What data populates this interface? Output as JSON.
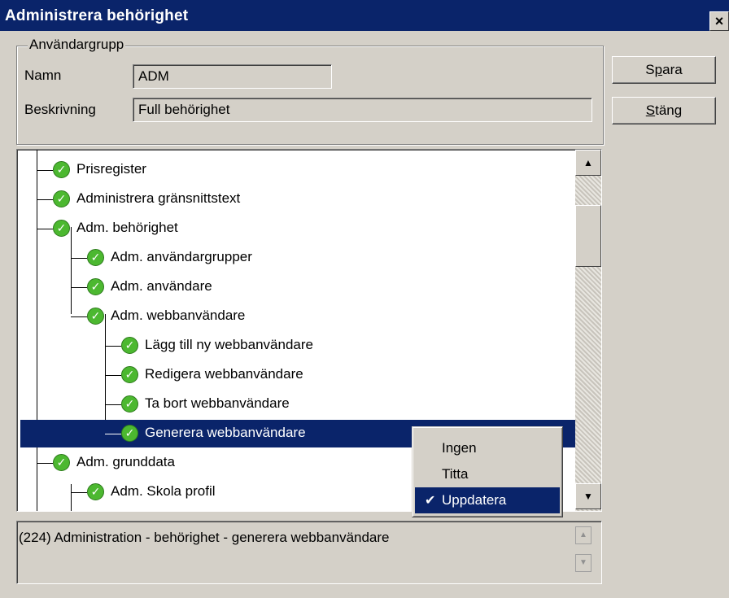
{
  "window": {
    "title": "Administrera behörighet",
    "close_label": "×"
  },
  "group": {
    "legend": "Användargrupp",
    "name_label": "Namn",
    "name_value": "ADM",
    "desc_label": "Beskrivning",
    "desc_value": "Full behörighet"
  },
  "buttons": {
    "save": {
      "pre": "S",
      "mnemonic": "p",
      "post": "ara"
    },
    "close": {
      "pre": "",
      "mnemonic": "S",
      "post": "täng"
    }
  },
  "tree": {
    "items": [
      {
        "label": "Prisregister"
      },
      {
        "label": "Administrera gränsnittstext"
      },
      {
        "label": "Adm. behörighet"
      },
      {
        "label": "Adm. användargrupper"
      },
      {
        "label": "Adm. användare"
      },
      {
        "label": "Adm. webbanvändare"
      },
      {
        "label": "Lägg till ny webbanvändare"
      },
      {
        "label": "Redigera webbanvändare"
      },
      {
        "label": "Ta bort webbanvändare"
      },
      {
        "label": "Generera webbanvändare"
      },
      {
        "label": "Adm. grunddata"
      },
      {
        "label": "Adm. Skola profil"
      },
      {
        "label": ""
      }
    ],
    "selected_index": 9,
    "check_glyph": "✓"
  },
  "info": {
    "text": "(224) Administration - behörighet - generera webbanvändare"
  },
  "context_menu": {
    "items": [
      {
        "label": "Ingen",
        "checked": false
      },
      {
        "label": "Titta",
        "checked": false
      },
      {
        "label": "Uppdatera",
        "checked": true
      }
    ],
    "check_glyph": "✔"
  },
  "icons": {
    "arrow_up": "▲",
    "arrow_down": "▼"
  }
}
